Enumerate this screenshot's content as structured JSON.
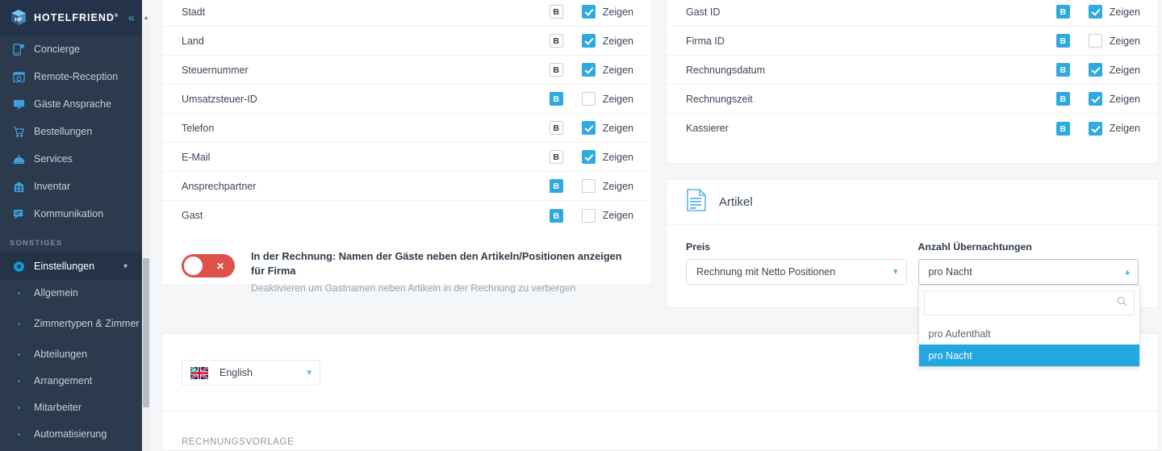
{
  "brand": {
    "name": "HOTELFRIEND",
    "registered": "®",
    "collapse_icon": "chevron-double-left-icon",
    "logo_icon": "hotelfriend-cube-logo"
  },
  "sidebar": {
    "items": [
      {
        "label": "Concierge",
        "icon": "mobile-concierge-icon"
      },
      {
        "label": "Remote-Reception",
        "icon": "remote-reception-icon"
      },
      {
        "label": "Gäste Ansprache",
        "icon": "guest-address-icon"
      },
      {
        "label": "Bestellungen",
        "icon": "shopping-cart-icon"
      },
      {
        "label": "Services",
        "icon": "room-service-icon"
      },
      {
        "label": "Inventar",
        "icon": "inventory-building-icon"
      },
      {
        "label": "Kommunikation",
        "icon": "chat-bubble-icon"
      }
    ],
    "section_label": "SONSTIGES",
    "settings": {
      "label": "Einstellungen",
      "icon": "gear-icon",
      "chevron": "chevron-down-icon"
    },
    "sub_items": [
      {
        "label": "Allgemein"
      },
      {
        "label": "Zimmertypen & Zimmer"
      },
      {
        "label": "Abteilungen"
      },
      {
        "label": "Arrangement"
      },
      {
        "label": "Mitarbeiter"
      },
      {
        "label": "Automatisierung"
      }
    ]
  },
  "left_card": {
    "rows": [
      {
        "label": "Stadt",
        "b_active": false,
        "checked": true,
        "checkbox_label": "Zeigen"
      },
      {
        "label": "Land",
        "b_active": false,
        "checked": true,
        "checkbox_label": "Zeigen"
      },
      {
        "label": "Steuernummer",
        "b_active": false,
        "checked": true,
        "checkbox_label": "Zeigen"
      },
      {
        "label": "Umsatzsteuer-ID",
        "b_active": true,
        "checked": false,
        "checkbox_label": "Zeigen"
      },
      {
        "label": "Telefon",
        "b_active": false,
        "checked": true,
        "checkbox_label": "Zeigen"
      },
      {
        "label": "E-Mail",
        "b_active": false,
        "checked": true,
        "checkbox_label": "Zeigen"
      },
      {
        "label": "Ansprechpartner",
        "b_active": true,
        "checked": false,
        "checkbox_label": "Zeigen"
      },
      {
        "label": "Gast",
        "b_active": true,
        "checked": false,
        "checkbox_label": "Zeigen"
      }
    ],
    "b_button_text": "B",
    "toggle": {
      "state": "off",
      "title": "In der Rechnung: Namen der Gäste neben den Artikeln/Positionen anzeigen für Firma",
      "subtitle": "Deaktivieren um Gastnamen neben Artikeln in der Rechnung zu verbergen",
      "icon": "close-x-icon"
    }
  },
  "right_card": {
    "rows": [
      {
        "label": "Gast ID",
        "b_active": true,
        "checked": true,
        "checkbox_label": "Zeigen"
      },
      {
        "label": "Firma ID",
        "b_active": true,
        "checked": false,
        "checkbox_label": "Zeigen"
      },
      {
        "label": "Rechnungsdatum",
        "b_active": true,
        "checked": true,
        "checkbox_label": "Zeigen"
      },
      {
        "label": "Rechnungszeit",
        "b_active": true,
        "checked": true,
        "checkbox_label": "Zeigen"
      },
      {
        "label": "Kassierer",
        "b_active": true,
        "checked": true,
        "checkbox_label": "Zeigen"
      }
    ],
    "b_button_text": "B"
  },
  "artikel_card": {
    "title": "Artikel",
    "icon": "document-list-icon",
    "preis": {
      "label": "Preis",
      "value": "Rechnung mit Netto Positionen",
      "caret": "chevron-down-icon"
    },
    "uebernachtungen": {
      "label": "Anzahl Übernachtungen",
      "value": "pro Nacht",
      "caret": "chevron-up-icon",
      "search_value": "",
      "search_placeholder": "",
      "search_icon": "search-icon",
      "options": [
        {
          "label": "pro Aufenthalt",
          "selected": false
        },
        {
          "label": "pro Nacht",
          "selected": true
        }
      ]
    }
  },
  "bottom_card": {
    "language": {
      "value": "English",
      "flag_icon": "uk-flag-icon",
      "verified_icon": "check-badge-icon",
      "caret": "chevron-down-icon"
    },
    "section_title": "RECHNUNGSVORLAGE"
  },
  "colors": {
    "accent": "#2eaae0",
    "sidebar_bg": "#2b3a4d",
    "sidebar_header_bg": "#25334a",
    "toggle_off": "#e0514c",
    "page_bg": "#f4f6f8",
    "dropdown_selected": "#22a7e0"
  }
}
